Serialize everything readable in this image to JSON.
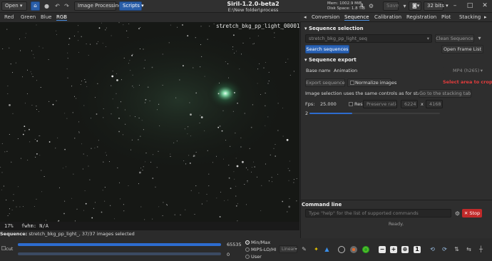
{
  "header": {
    "open_label": "Open",
    "image_processing_label": "Image Processing",
    "scripts_label": "Scripts",
    "title": "Siril-1.2.0-beta2",
    "subtitle": "E:\\New folder\\process",
    "mem": "Mem: 1002.9 MiB",
    "disk": "Disk Space: 1.8 TiB",
    "thread_count": "4",
    "save_label": "Save",
    "bits_label": "32 bits"
  },
  "channels": [
    "Red",
    "Green",
    "Blue",
    "RGB"
  ],
  "image": {
    "filename": "stretch_bkg_pp_light_00001.fit",
    "zoom": "17%",
    "fwhm": "fwhm: N/A"
  },
  "sequence_line": {
    "prefix": "Sequence:",
    "text": "stretch_bkg_pp_light_, 37/37 images selected"
  },
  "bottom": {
    "cut_label": "cut",
    "max_value": "65535",
    "min_value": "0",
    "radio_options": [
      "Min/Max",
      "MIPS-LO/HI",
      "User"
    ],
    "mode_combo": "Linear"
  },
  "right_tabs": [
    "Conversion",
    "Sequence",
    "Calibration",
    "Registration",
    "Plot",
    "Stacking"
  ],
  "sequence_panel": {
    "selection_title": "Sequence selection",
    "sequence_value": "stretch_bkg_pp_light_seq",
    "clean_label": "Clean Sequence",
    "search_label": "Search sequences",
    "frame_list_label": "Open Frame List",
    "export_title": "Sequence export",
    "base_name_label": "Base name:",
    "base_name_value": "Animation",
    "format_value": "MP4 (h265)",
    "export_label": "Export sequence",
    "normalize_label": "Normalize images",
    "crop_warning": "Select area to crop",
    "stacking_note": "Image selection uses the same controls as for stacking:",
    "goto_stacking_label": "Go to the stacking tab",
    "fps_label": "Fps:",
    "fps_value": "25.000",
    "resize_label": "Resize",
    "preserve_label": "Preserve ratio",
    "width_value": "6224",
    "x_label": "x",
    "height_value": "4168",
    "quality_value": "2"
  },
  "command_line": {
    "title": "Command line",
    "placeholder": "Type \"help\" for the list of supported commands",
    "stop_label": "Stop",
    "status": "Ready."
  }
}
